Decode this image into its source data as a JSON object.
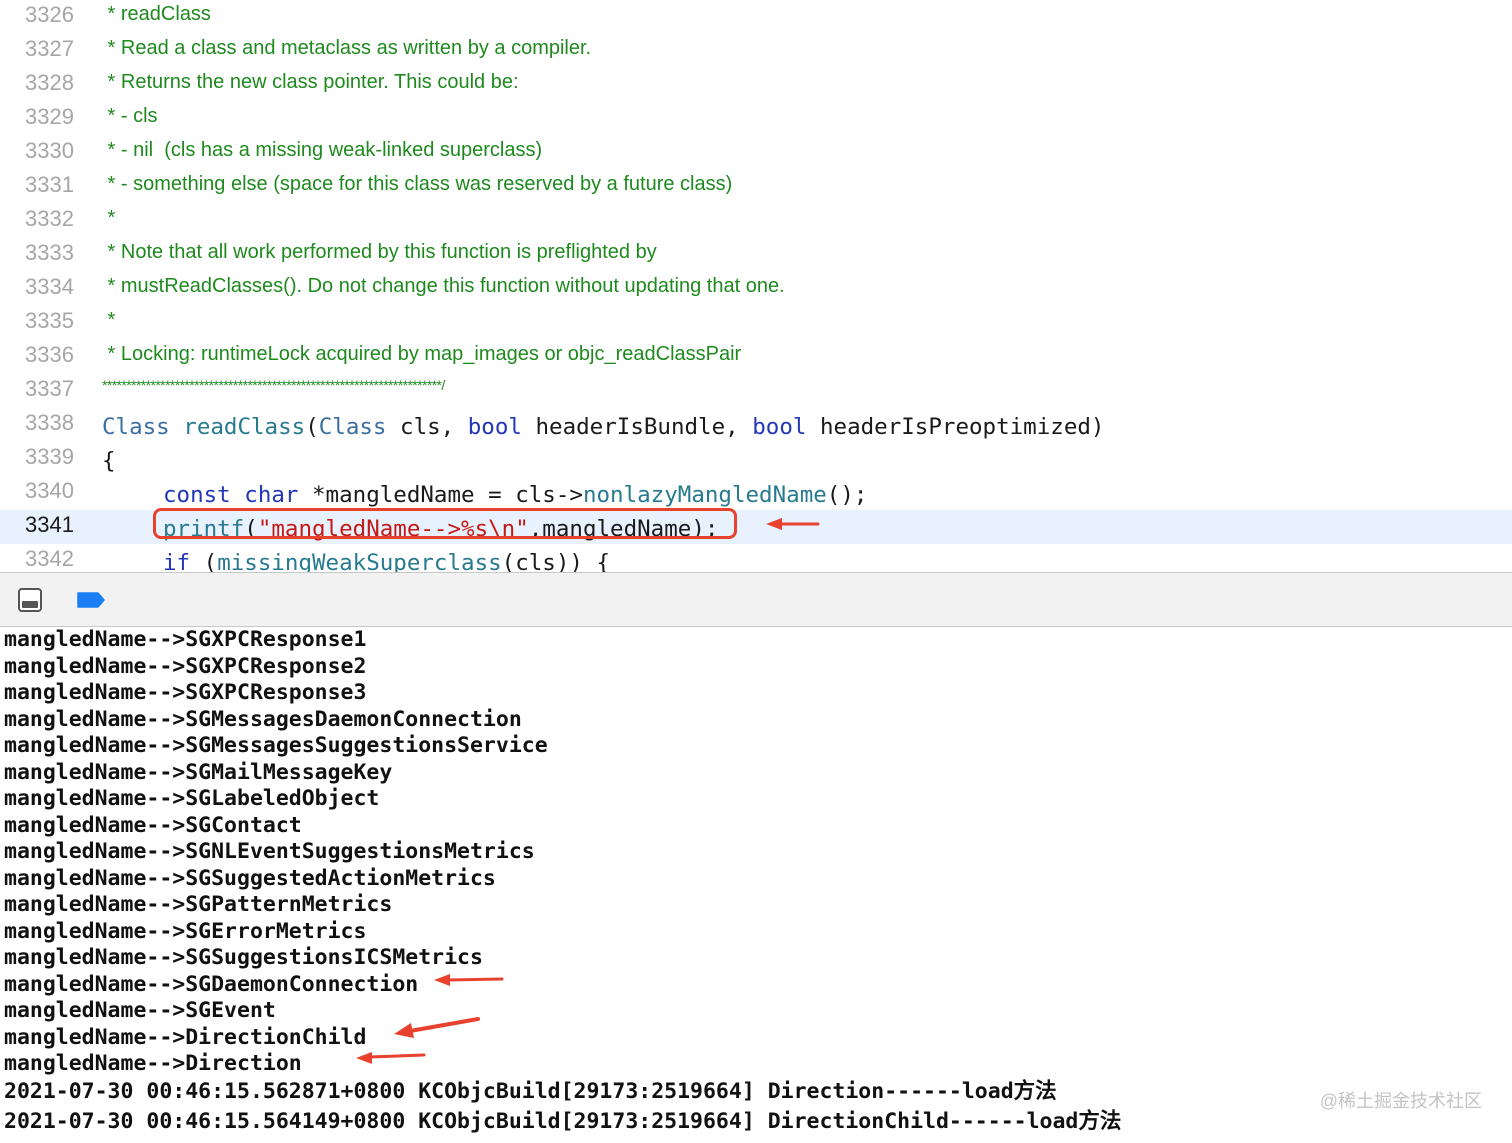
{
  "editor": {
    "lines": [
      {
        "num": "3326",
        "comment": " * readClass"
      },
      {
        "num": "3327",
        "comment": " * Read a class and metaclass as written by a compiler."
      },
      {
        "num": "3328",
        "comment": " * Returns the new class pointer. This could be:"
      },
      {
        "num": "3329",
        "comment": " * - cls"
      },
      {
        "num": "3330",
        "comment": " * - nil  (cls has a missing weak-linked superclass)"
      },
      {
        "num": "3331",
        "comment": " * - something else (space for this class was reserved by a future class)"
      },
      {
        "num": "3332",
        "comment": " *"
      },
      {
        "num": "3333",
        "comment": " * Note that all work performed by this function is preflighted by"
      },
      {
        "num": "3334",
        "comment": " * mustReadClasses(). Do not change this function without updating that one."
      },
      {
        "num": "3335",
        "comment": " *"
      },
      {
        "num": "3336",
        "comment": " * Locking: runtimeLock acquired by map_images or objc_readClassPair"
      },
      {
        "num": "3337",
        "comment": "**********************************************************************/"
      },
      {
        "num": "3338"
      },
      {
        "num": "3339"
      },
      {
        "num": "3340"
      },
      {
        "num": "3341"
      },
      {
        "num": "3342"
      }
    ],
    "l3338": {
      "t1": "Class",
      "t2": " ",
      "t3": "readClass",
      "t4": "(",
      "t5": "Class",
      "t6": " cls, ",
      "t7": "bool",
      "t8": " headerIsBundle, ",
      "t9": "bool",
      "t10": " headerIsPreoptimized)"
    },
    "l3339": {
      "t1": "{"
    },
    "l3340": {
      "t1": "const",
      "t2": " ",
      "t3": "char",
      "t4": " *mangledName = cls->",
      "t5": "nonlazyMangledName",
      "t6": "();"
    },
    "l3341": {
      "t1": "printf",
      "t2": "(",
      "t3": "\"mangledName-->%s\\n\"",
      "t4": ",mangledName);"
    },
    "l3342": {
      "t1": "if",
      "t2": " (",
      "t3": "missingWeakSuperclass",
      "t4": "(cls)) {"
    }
  },
  "debug_bar": {
    "panel_icon": "bottom-panel-icon",
    "breakpoint_icon": "breakpoint-icon",
    "breakpoint_color": "#1a7ef5"
  },
  "console": {
    "lines": [
      "mangledName-->SGXPCResponse1",
      "mangledName-->SGXPCResponse2",
      "mangledName-->SGXPCResponse3",
      "mangledName-->SGMessagesDaemonConnection",
      "mangledName-->SGMessagesSuggestionsService",
      "mangledName-->SGMailMessageKey",
      "mangledName-->SGLabeledObject",
      "mangledName-->SGContact",
      "mangledName-->SGNLEventSuggestionsMetrics",
      "mangledName-->SGSuggestedActionMetrics",
      "mangledName-->SGPatternMetrics",
      "mangledName-->SGErrorMetrics",
      "mangledName-->SGSuggestionsICSMetrics",
      "mangledName-->SGDaemonConnection",
      "mangledName-->SGEvent",
      "mangledName-->DirectionChild",
      "mangledName-->Direction",
      "2021-07-30 00:46:15.562871+0800 KCObjcBuild[29173:2519664] Direction------load方法",
      "2021-07-30 00:46:15.564149+0800 KCObjcBuild[29173:2519664] DirectionChild------load方法"
    ]
  },
  "annotation_color": "#e8412d",
  "watermark": "@稀土掘金技术社区"
}
